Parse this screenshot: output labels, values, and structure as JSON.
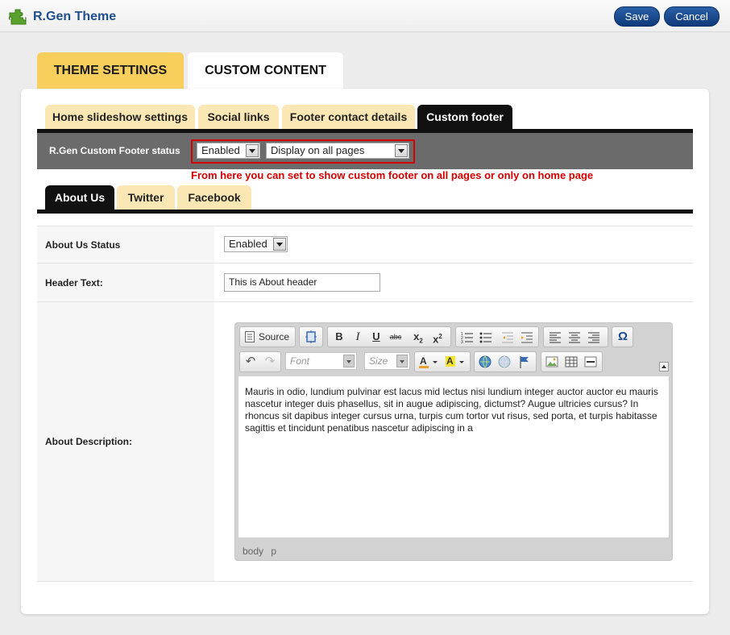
{
  "header": {
    "title": "R.Gen Theme",
    "save_label": "Save",
    "cancel_label": "Cancel",
    "logo_icon": "puzzle-piece-icon",
    "brand_color": "#1d4f91"
  },
  "main_tabs": [
    {
      "label": "THEME SETTINGS",
      "active": false
    },
    {
      "label": "CUSTOM CONTENT",
      "active": true
    }
  ],
  "sub_tabs": [
    {
      "label": "Home slideshow settings",
      "active": false
    },
    {
      "label": "Social links",
      "active": false
    },
    {
      "label": "Footer contact details",
      "active": false
    },
    {
      "label": "Custom footer",
      "active": true
    }
  ],
  "footer_status": {
    "label": "R.Gen Custom Footer status",
    "status_value": "Enabled",
    "display_value": "Display on all pages",
    "hint": "From here you can set to show custom footer on all pages or only on home page"
  },
  "inner_tabs": [
    {
      "label": "About Us",
      "active": true
    },
    {
      "label": "Twitter",
      "active": false
    },
    {
      "label": "Facebook",
      "active": false
    }
  ],
  "form": {
    "about_status_label": "About Us Status",
    "about_status_value": "Enabled",
    "header_text_label": "Header Text:",
    "header_text_value": "This is About header",
    "description_label": "About Description:"
  },
  "editor": {
    "source_label": "Source",
    "font_placeholder": "Font",
    "size_placeholder": "Size",
    "content": "Mauris in odio, lundium pulvinar est lacus mid lectus nisi lundium integer auctor auctor eu mauris nascetur integer duis phasellus, sit in augue adipiscing, dictumst? Augue ultricies cursus? In rhoncus sit dapibus integer cursus urna, turpis cum tortor vut risus, sed porta, et turpis habitasse sagittis et tincidunt penatibus nascetur adipiscing in a",
    "path": "body p"
  }
}
